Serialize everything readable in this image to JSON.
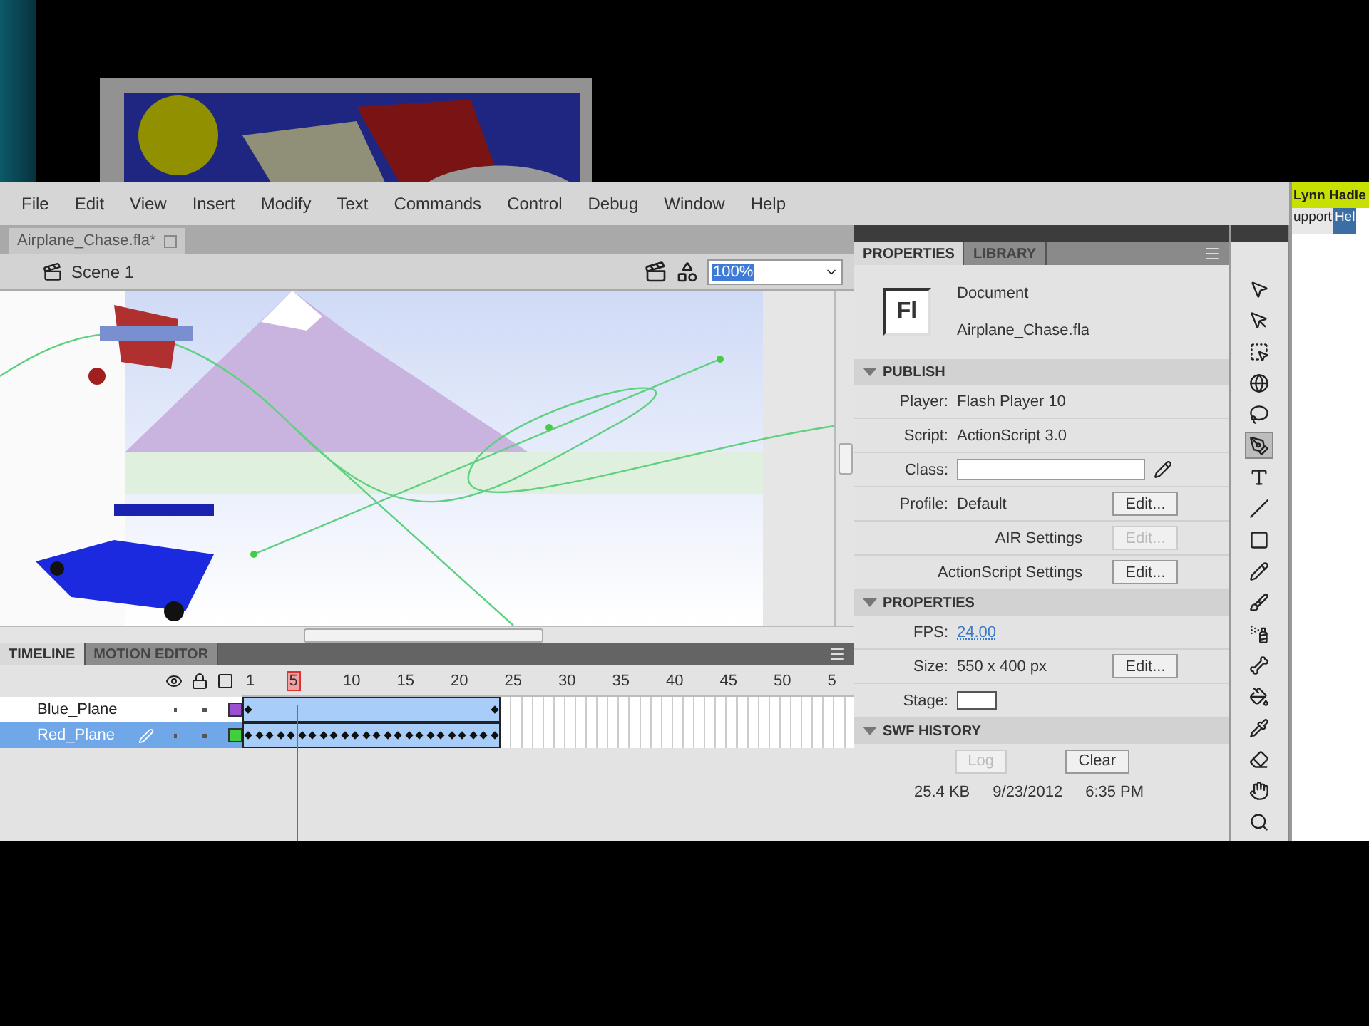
{
  "menu_bar": {
    "items": [
      "File",
      "Edit",
      "View",
      "Insert",
      "Modify",
      "Text",
      "Commands",
      "Control",
      "Debug",
      "Window",
      "Help"
    ]
  },
  "document_tab": {
    "title": "Airplane_Chase.fla*"
  },
  "scene_bar": {
    "scene": "Scene 1",
    "zoom": "100%"
  },
  "timeline": {
    "tabs": [
      {
        "label": "TIMELINE",
        "selected": true
      },
      {
        "label": "MOTION EDITOR",
        "selected": false
      }
    ],
    "ruler": [
      {
        "label": "1",
        "selected": false
      },
      {
        "label": "5",
        "selected": true
      },
      {
        "label": "10",
        "selected": false
      },
      {
        "label": "15",
        "selected": false
      },
      {
        "label": "20",
        "selected": false
      },
      {
        "label": "25",
        "selected": false
      },
      {
        "label": "30",
        "selected": false
      },
      {
        "label": "35",
        "selected": false
      },
      {
        "label": "40",
        "selected": false
      },
      {
        "label": "45",
        "selected": false
      },
      {
        "label": "50",
        "selected": false
      },
      {
        "label": "5",
        "selected": false
      }
    ],
    "layers": [
      {
        "name": "Blue_Plane",
        "selected": false,
        "editing": false,
        "color": "#9b4fd1",
        "keyframes_every_frame": false
      },
      {
        "name": "Red_Plane",
        "selected": true,
        "editing": true,
        "color": "#3fcf3f",
        "keyframes_every_frame": true
      }
    ]
  },
  "properties_panel": {
    "tabs": [
      {
        "label": "PROPERTIES",
        "selected": true
      },
      {
        "label": "LIBRARY",
        "selected": false
      }
    ],
    "document": {
      "icon_text": "Fl",
      "type": "Document",
      "name": "Airplane_Chase.fla"
    },
    "sections": [
      {
        "title": "PUBLISH",
        "expanded": true,
        "rows": [
          {
            "kind": "info",
            "label": "Player:",
            "value": "Flash Player 10"
          },
          {
            "kind": "info",
            "label": "Script:",
            "value": "ActionScript 3.0"
          },
          {
            "kind": "field",
            "label": "Class:"
          },
          {
            "kind": "button",
            "label": "Profile:",
            "value": "Default",
            "button": {
              "label": "Edit...",
              "disabled": false
            }
          },
          {
            "kind": "button",
            "label": "AIR Settings",
            "button": {
              "label": "Edit...",
              "disabled": true
            }
          },
          {
            "kind": "button",
            "label": "ActionScript Settings",
            "button": {
              "label": "Edit...",
              "disabled": false
            }
          }
        ]
      },
      {
        "title": "PROPERTIES",
        "expanded": true,
        "rows": [
          {
            "kind": "link",
            "label": "FPS:",
            "value": "24.00"
          },
          {
            "kind": "button",
            "label": "Size:",
            "value": "550 x 400 px",
            "button": {
              "label": "Edit...",
              "disabled": false
            }
          },
          {
            "kind": "swatch",
            "label": "Stage:"
          }
        ]
      },
      {
        "title": "SWF HISTORY",
        "expanded": true,
        "rows": [
          {
            "kind": "buttons",
            "buttons": [
              {
                "label": "Log",
                "disabled": true
              },
              {
                "label": "Clear",
                "disabled": false
              }
            ]
          },
          {
            "kind": "stats",
            "texts": [
              "25.4 KB",
              "9/23/2012",
              "6:35 PM"
            ]
          }
        ]
      }
    ]
  },
  "tools": [
    {
      "kind": "selection",
      "selected": false
    },
    {
      "kind": "subselection",
      "selected": false
    },
    {
      "kind": "transform",
      "selected": false
    },
    {
      "kind": "rotation3d",
      "selected": false
    },
    {
      "kind": "lasso",
      "selected": false
    },
    {
      "kind": "pen",
      "selected": true
    },
    {
      "kind": "text",
      "selected": false
    },
    {
      "kind": "line",
      "selected": false
    },
    {
      "kind": "rectangle",
      "selected": false
    },
    {
      "kind": "pencil",
      "selected": false
    },
    {
      "kind": "brush",
      "selected": false
    },
    {
      "kind": "deco",
      "selected": false
    },
    {
      "kind": "bone",
      "selected": false
    },
    {
      "kind": "bucket",
      "selected": false
    },
    {
      "kind": "eyedropper",
      "selected": false
    },
    {
      "kind": "eraser",
      "selected": false
    },
    {
      "kind": "hand",
      "selected": false
    },
    {
      "kind": "zoom",
      "selected": false
    }
  ],
  "browser_strip": {
    "user": "Lynn Hadle",
    "tabs": [
      {
        "label": "upport",
        "selected": false
      },
      {
        "label": "Hel",
        "selected": true
      }
    ]
  }
}
